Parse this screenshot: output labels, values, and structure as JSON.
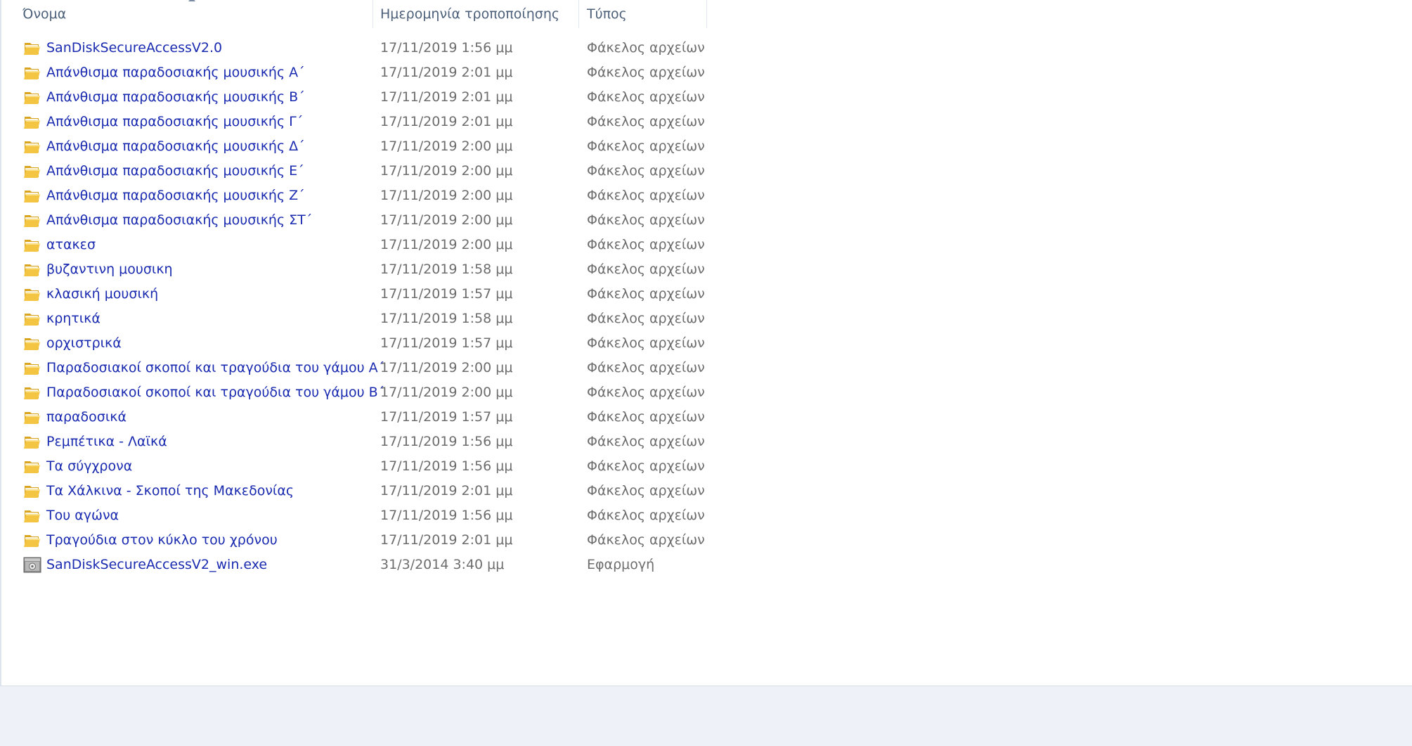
{
  "columns": {
    "name": "Όνομα",
    "date": "Ημερομηνία τροποποίησης",
    "type": "Τύπος"
  },
  "icons": {
    "folder": "folder-icon",
    "application": "application-icon"
  },
  "colors": {
    "link_text": "#1a2bb0",
    "secondary_text": "#6d6d6d",
    "header_text": "#4c607a"
  },
  "files": [
    {
      "name": "SanDiskSecureAccessV2.0",
      "date": "17/11/2019 1:56 μμ",
      "type": "Φάκελος αρχείων",
      "icon": "folder"
    },
    {
      "name": "Απάνθισμα παραδοσιακής μουσικής Α΄",
      "date": "17/11/2019 2:01 μμ",
      "type": "Φάκελος αρχείων",
      "icon": "folder"
    },
    {
      "name": "Απάνθισμα παραδοσιακής μουσικής Β΄",
      "date": "17/11/2019 2:01 μμ",
      "type": "Φάκελος αρχείων",
      "icon": "folder"
    },
    {
      "name": "Απάνθισμα παραδοσιακής μουσικής Γ΄",
      "date": "17/11/2019 2:01 μμ",
      "type": "Φάκελος αρχείων",
      "icon": "folder"
    },
    {
      "name": "Απάνθισμα παραδοσιακής μουσικής Δ΄",
      "date": "17/11/2019 2:00 μμ",
      "type": "Φάκελος αρχείων",
      "icon": "folder"
    },
    {
      "name": "Απάνθισμα παραδοσιακής μουσικής Ε΄",
      "date": "17/11/2019 2:00 μμ",
      "type": "Φάκελος αρχείων",
      "icon": "folder"
    },
    {
      "name": "Απάνθισμα παραδοσιακής μουσικής Ζ΄",
      "date": "17/11/2019 2:00 μμ",
      "type": "Φάκελος αρχείων",
      "icon": "folder"
    },
    {
      "name": "Απάνθισμα παραδοσιακής μουσικής ΣΤ΄",
      "date": "17/11/2019 2:00 μμ",
      "type": "Φάκελος αρχείων",
      "icon": "folder"
    },
    {
      "name": "ατακεσ",
      "date": "17/11/2019 2:00 μμ",
      "type": "Φάκελος αρχείων",
      "icon": "folder"
    },
    {
      "name": "βυζαντινη μουσικη",
      "date": "17/11/2019 1:58 μμ",
      "type": "Φάκελος αρχείων",
      "icon": "folder"
    },
    {
      "name": "κλασική μουσική",
      "date": "17/11/2019 1:57 μμ",
      "type": "Φάκελος αρχείων",
      "icon": "folder"
    },
    {
      "name": "κρητικά",
      "date": "17/11/2019 1:58 μμ",
      "type": "Φάκελος αρχείων",
      "icon": "folder"
    },
    {
      "name": "ορχιστρικά",
      "date": "17/11/2019 1:57 μμ",
      "type": "Φάκελος αρχείων",
      "icon": "folder"
    },
    {
      "name": "Παραδοσιακοί σκοποί και τραγούδια του γάμου Α΄",
      "date": "17/11/2019 2:00 μμ",
      "type": "Φάκελος αρχείων",
      "icon": "folder"
    },
    {
      "name": "Παραδοσιακοί σκοποί και τραγούδια του γάμου Β΄",
      "date": "17/11/2019 2:00 μμ",
      "type": "Φάκελος αρχείων",
      "icon": "folder"
    },
    {
      "name": "παραδοσικά",
      "date": "17/11/2019 1:57 μμ",
      "type": "Φάκελος αρχείων",
      "icon": "folder"
    },
    {
      "name": "Ρεμπέτικα - Λαϊκά",
      "date": "17/11/2019 1:56 μμ",
      "type": "Φάκελος αρχείων",
      "icon": "folder"
    },
    {
      "name": "Τα σύγχρονα",
      "date": "17/11/2019 1:56 μμ",
      "type": "Φάκελος αρχείων",
      "icon": "folder"
    },
    {
      "name": "Τα Χάλκινα - Σκοποί της Μακεδονίας",
      "date": "17/11/2019 2:01 μμ",
      "type": "Φάκελος αρχείων",
      "icon": "folder"
    },
    {
      "name": "Του αγώνα",
      "date": "17/11/2019 1:56 μμ",
      "type": "Φάκελος αρχείων",
      "icon": "folder"
    },
    {
      "name": "Τραγούδια στον κύκλο του χρόνου",
      "date": "17/11/2019 2:01 μμ",
      "type": "Φάκελος αρχείων",
      "icon": "folder"
    },
    {
      "name": "SanDiskSecureAccessV2_win.exe",
      "date": "31/3/2014 3:40 μμ",
      "type": "Εφαρμογή",
      "icon": "application"
    }
  ]
}
